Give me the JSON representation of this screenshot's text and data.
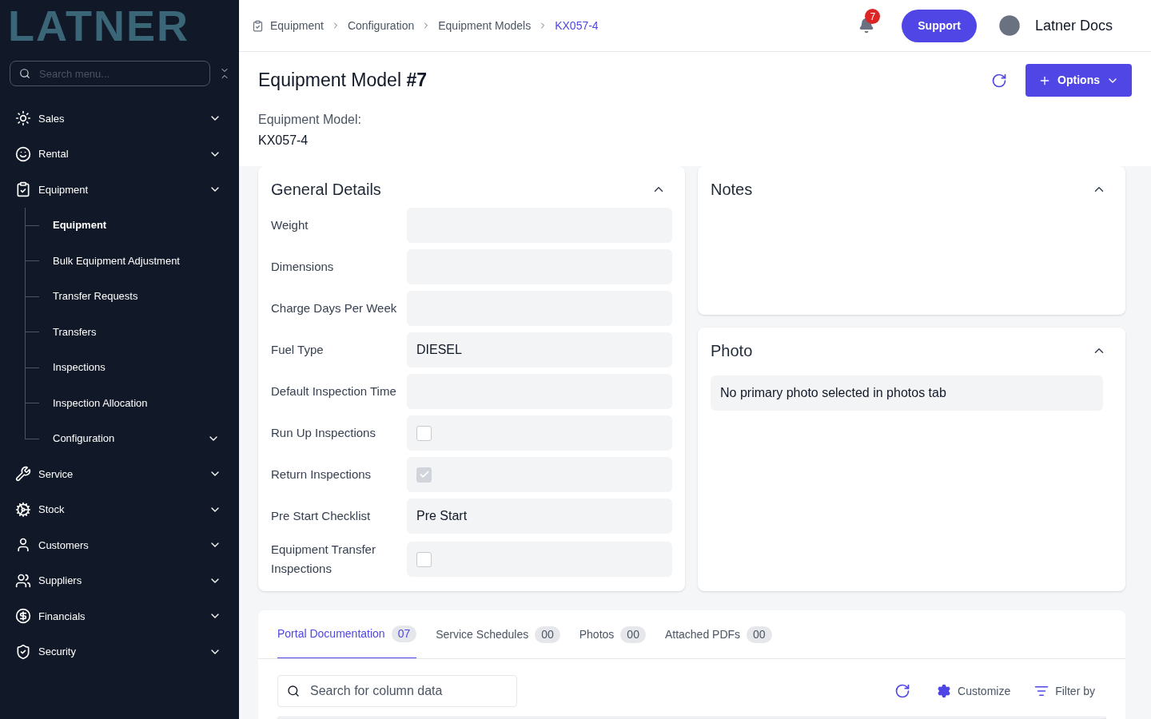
{
  "logo": "LATNER",
  "sidebar": {
    "search": {
      "placeholder": "Search menu..."
    },
    "items": [
      {
        "label": "Sales"
      },
      {
        "label": "Rental"
      },
      {
        "label": "Equipment",
        "children": [
          {
            "label": "Equipment",
            "selected": true
          },
          {
            "label": "Bulk Equipment Adjustment",
            "selected": false
          },
          {
            "label": "Transfer Requests",
            "selected": false
          },
          {
            "label": "Transfers",
            "selected": false
          },
          {
            "label": "Inspections",
            "selected": false
          },
          {
            "label": "Inspection Allocation",
            "selected": false
          },
          {
            "label": "Configuration",
            "selected": false,
            "expandable": true
          }
        ]
      },
      {
        "label": "Service"
      },
      {
        "label": "Stock"
      },
      {
        "label": "Customers"
      },
      {
        "label": "Suppliers"
      },
      {
        "label": "Financials"
      },
      {
        "label": "Security"
      }
    ]
  },
  "breadcrumbs": [
    "Equipment",
    "Configuration",
    "Equipment Models",
    "KX057-4"
  ],
  "notifications": {
    "count": "7"
  },
  "support_button": "Support",
  "user": {
    "name": "Latner Docs"
  },
  "page": {
    "title": "Equipment Model",
    "number": "#7",
    "options_button": "Options",
    "subtitle_label": "Equipment Model:",
    "subtitle_value": "KX057-4"
  },
  "general_details": {
    "title": "General Details",
    "expanded": true,
    "fields": [
      {
        "label": "Weight",
        "kind": "text"
      },
      {
        "label": "Dimensions",
        "kind": "text"
      },
      {
        "label": "Charge Days Per Week",
        "kind": "text"
      },
      {
        "label": "Fuel Type",
        "kind": "text",
        "value": "DIESEL"
      },
      {
        "label": "Default Inspection Time",
        "kind": "text"
      },
      {
        "label": "Run Up Inspections",
        "kind": "checkbox",
        "checked": false,
        "disabled": false
      },
      {
        "label": "Return Inspections",
        "kind": "checkbox",
        "checked": true,
        "disabled": true
      },
      {
        "label": "Pre Start Checklist",
        "kind": "text",
        "value": "Pre Start"
      },
      {
        "label": "Equipment Transfer Inspections",
        "kind": "checkbox",
        "checked": false,
        "disabled": false
      }
    ]
  },
  "notes": {
    "title": "Notes",
    "expanded": true
  },
  "photo": {
    "title": "Photo",
    "expanded": true,
    "message": "No primary photo selected in photos tab"
  },
  "tabs": [
    {
      "label": "Portal Documentation",
      "count": "07",
      "selected": true
    },
    {
      "label": "Service Schedules",
      "count": "00",
      "selected": false
    },
    {
      "label": "Photos",
      "count": "00",
      "selected": false
    },
    {
      "label": "Attached PDFs",
      "count": "00",
      "selected": false
    }
  ],
  "table_toolbar": {
    "search_placeholder": "Search for column data",
    "customize": "Customize",
    "filter": "Filter by"
  }
}
